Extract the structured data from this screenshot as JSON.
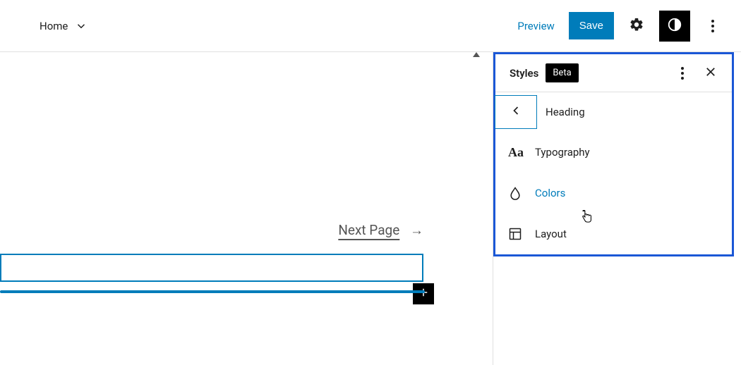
{
  "topbar": {
    "home_label": "Home",
    "preview_label": "Preview",
    "save_label": "Save"
  },
  "panel": {
    "title": "Styles",
    "badge": "Beta",
    "heading_label": "Heading",
    "items": {
      "typography": "Typography",
      "colors": "Colors",
      "layout": "Layout"
    }
  },
  "content": {
    "next_page_label": "Next Page",
    "next_page_arrow": "→"
  },
  "colors": {
    "accent": "#007cba",
    "panel_border": "#1a57d6"
  }
}
